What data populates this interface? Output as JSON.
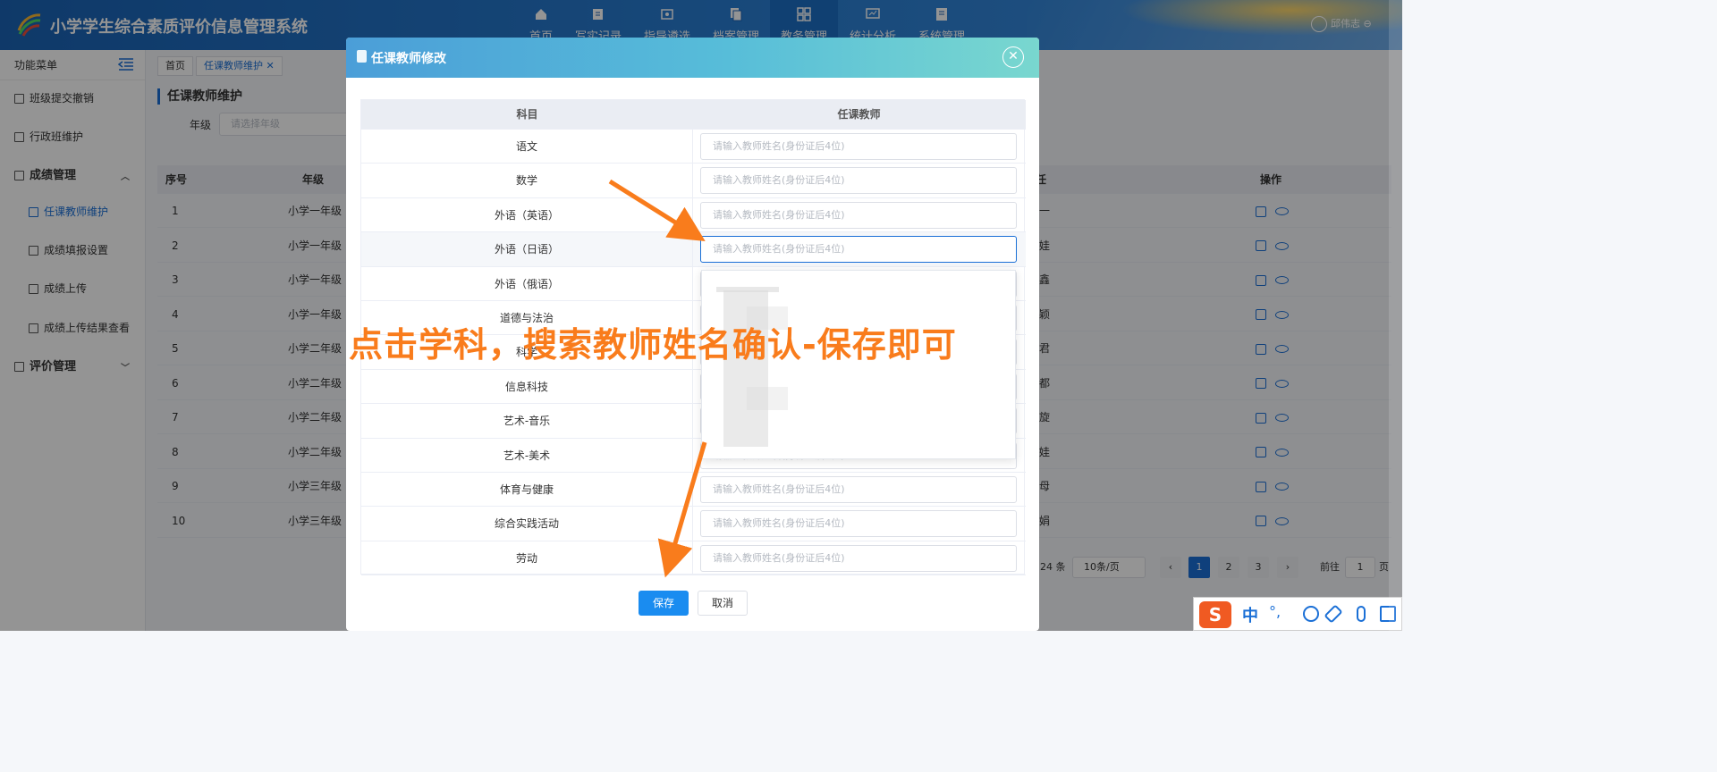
{
  "app": {
    "title": "小学学生综合素质评价信息管理系统",
    "user": "邱伟志"
  },
  "nav": [
    {
      "label": "首页",
      "icon": "home-icon"
    },
    {
      "label": "写实记录",
      "icon": "edit-icon"
    },
    {
      "label": "指导遴选",
      "icon": "guide-icon"
    },
    {
      "label": "档案管理",
      "icon": "archive-icon"
    },
    {
      "label": "教务管理",
      "icon": "grid-icon",
      "active": true
    },
    {
      "label": "统计分析",
      "icon": "chart-icon"
    },
    {
      "label": "系统管理",
      "icon": "system-icon"
    }
  ],
  "sidebar": {
    "header": "功能菜单",
    "items": [
      {
        "label": "班级提交撤销"
      },
      {
        "label": "行政班维护"
      },
      {
        "label": "成绩管理"
      },
      {
        "label": "任课教师维护"
      },
      {
        "label": "成绩填报设置"
      },
      {
        "label": "成绩上传"
      },
      {
        "label": "成绩上传结果查看"
      },
      {
        "label": "评价管理"
      }
    ]
  },
  "tabs": [
    {
      "label": "首页"
    },
    {
      "label": "任课教师维护"
    }
  ],
  "page": {
    "title": "任课教师维护",
    "grade_label": "年级",
    "grade_placeholder": "请选择年级"
  },
  "table": {
    "columns": {
      "index": "序号",
      "grade": "年级",
      "teacher": "任",
      "ops": "操作"
    },
    "rows": [
      {
        "index": "1",
        "grade": "小学一年级",
        "tail": "一"
      },
      {
        "index": "2",
        "grade": "小学一年级",
        "tail": "娃"
      },
      {
        "index": "3",
        "grade": "小学一年级",
        "tail": "鑫"
      },
      {
        "index": "4",
        "grade": "小学一年级",
        "tail": "颖"
      },
      {
        "index": "5",
        "grade": "小学二年级",
        "tail": "君"
      },
      {
        "index": "6",
        "grade": "小学二年级",
        "tail": "都"
      },
      {
        "index": "7",
        "grade": "小学二年级",
        "tail": "旋"
      },
      {
        "index": "8",
        "grade": "小学二年级",
        "tail": "娃"
      },
      {
        "index": "9",
        "grade": "小学三年级",
        "tail": "母"
      },
      {
        "index": "10",
        "grade": "小学三年级",
        "tail": "娟"
      }
    ]
  },
  "pagination": {
    "total": "24 条",
    "page_size": "10条/页",
    "pages": [
      "1",
      "2",
      "3"
    ],
    "goto_label": "前往",
    "goto_value": "1",
    "page_suffix": "页"
  },
  "modal": {
    "title": "任课教师修改",
    "col_subject": "科目",
    "col_teacher": "任课教师",
    "placeholder": "请输入教师姓名(身份证后4位)",
    "subjects": [
      "语文",
      "数学",
      "外语（英语）",
      "外语（日语）",
      "外语（俄语）",
      "道德与法治",
      "科学",
      "信息科技",
      "艺术-音乐",
      "艺术-美术",
      "体育与健康",
      "综合实践活动",
      "劳动"
    ],
    "save": "保存",
    "cancel": "取消"
  },
  "annotation": "点击学科，搜索教师姓名确认-保存即可",
  "ime": {
    "lang": "中",
    "punct": "°,"
  },
  "colors": {
    "primary": "#1a6fd6",
    "header": "#1a63b5",
    "annotation": "#f97c1c",
    "save": "#1a8cf0"
  }
}
